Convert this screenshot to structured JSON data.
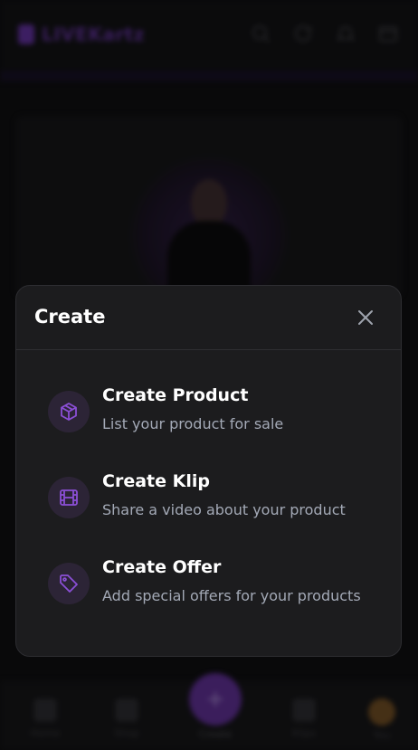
{
  "background": {
    "app_name": "LIVEKartz",
    "bottom_nav": {
      "items": [
        "Home",
        "Shop",
        "Create",
        "Klips",
        "You"
      ]
    }
  },
  "sheet": {
    "title": "Create",
    "options": [
      {
        "title": "Create Product",
        "description": "List your product for sale",
        "icon": "package-icon"
      },
      {
        "title": "Create Klip",
        "description": "Share a video about your product",
        "icon": "film-icon"
      },
      {
        "title": "Create Offer",
        "description": "Add special offers for your products",
        "icon": "tag-icon"
      }
    ]
  },
  "colors": {
    "accent": "#8b4fd6",
    "sheet_bg": "#1c1c1e",
    "icon_bg": "#2c2436"
  }
}
